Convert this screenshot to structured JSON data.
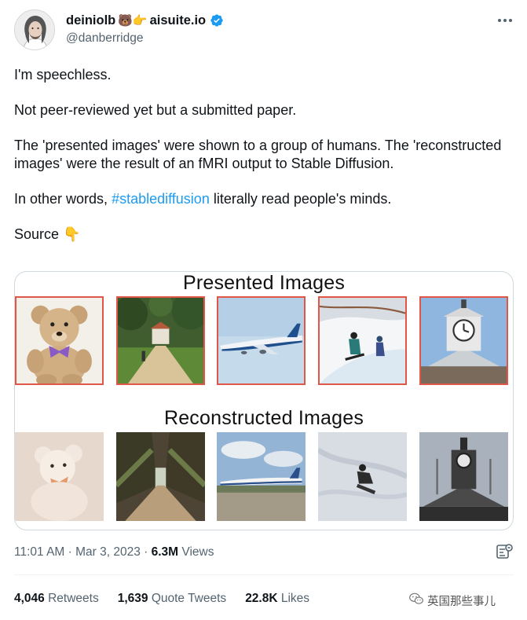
{
  "author": {
    "display_name": "deiniolb",
    "emojis": "🐻👉",
    "site_name": "aisuite.io",
    "handle": "@danberridge",
    "verified_icon": "verified-badge-icon",
    "avatar_icon": "user-avatar"
  },
  "tweet": {
    "paragraphs": [
      "I'm speechless.",
      "Not peer-reviewed yet but a submitted paper.",
      "The 'presented images' were shown to a group of humans. The 'reconstructed images' were the result of an fMRI output to Stable Diffusion."
    ],
    "p4_before": "In other words, ",
    "hashtag": "#stablediffusion",
    "p4_after": " literally read people's minds.",
    "source_label": "Source ",
    "source_emoji": "👇"
  },
  "media": {
    "presented_title": "Presented Images",
    "reconstructed_title": "Reconstructed Images",
    "presented": [
      "teddy-bear",
      "garden-path",
      "airplane",
      "snowboarders",
      "clock-tower"
    ],
    "reconstructed": [
      "teddy-bear",
      "tree-lined-path",
      "airplane",
      "snowboarder",
      "clock-tower"
    ]
  },
  "meta": {
    "time": "11:01 AM",
    "sep1": " · ",
    "date": "Mar 3, 2023",
    "sep2": " · ",
    "views_count": "6.3M",
    "views_label": " Views",
    "analytics_icon": "analytics-icon"
  },
  "stats": {
    "retweets_count": "4,046",
    "retweets_label": " Retweets",
    "quotes_count": "1,639",
    "quotes_label": " Quote Tweets",
    "likes_count": "22.8K",
    "likes_label": " Likes"
  },
  "watermark": {
    "text": "英国那些事儿",
    "icon": "wechat-icon"
  },
  "colors": {
    "accent": "#1d9bf0",
    "text": "#0f1419",
    "muted": "#536471",
    "frame": "#e0574a"
  }
}
